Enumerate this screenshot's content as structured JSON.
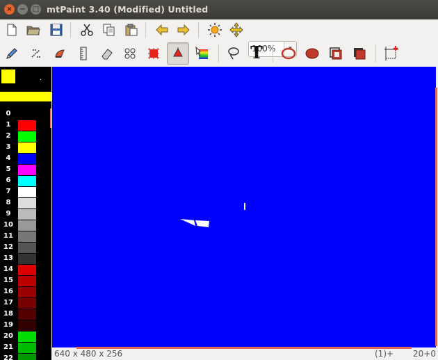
{
  "window": {
    "title": "mtPaint 3.40 (Modified) Untitled",
    "close_glyph": "×",
    "minimize_glyph": "−",
    "maximize_glyph": "□"
  },
  "toolbar_main": {
    "zoom_value": "100%",
    "zoom_arrow": "▾",
    "icons": [
      "new-file-icon",
      "open-folder-icon",
      "save-icon",
      "cut-icon",
      "copy-icon",
      "paste-icon",
      "undo-arrow-icon",
      "redo-arrow-icon",
      "brightness-sun-icon",
      "pan-move-icon"
    ]
  },
  "toolbar_tools": {
    "text_tool_label": "T",
    "overflow_arrow": "▾",
    "active_tool": "fill-tool-icon"
  },
  "palette": {
    "foreground_color": "#ffff00",
    "background_color": "#000000",
    "pattern_color": "#ffff00",
    "entries": [
      {
        "index": "0",
        "color": "#000000"
      },
      {
        "index": "1",
        "color": "#ff0000"
      },
      {
        "index": "2",
        "color": "#00ff00"
      },
      {
        "index": "3",
        "color": "#ffff00"
      },
      {
        "index": "4",
        "color": "#0000ff"
      },
      {
        "index": "5",
        "color": "#ff00ff"
      },
      {
        "index": "6",
        "color": "#00ffff"
      },
      {
        "index": "7",
        "color": "#ffffff"
      },
      {
        "index": "8",
        "color": "#dddddd"
      },
      {
        "index": "9",
        "color": "#bbbbbb"
      },
      {
        "index": "10",
        "color": "#999999"
      },
      {
        "index": "11",
        "color": "#777777"
      },
      {
        "index": "12",
        "color": "#555555"
      },
      {
        "index": "13",
        "color": "#333333"
      },
      {
        "index": "14",
        "color": "#dd0000"
      },
      {
        "index": "15",
        "color": "#bb0000"
      },
      {
        "index": "16",
        "color": "#990000"
      },
      {
        "index": "17",
        "color": "#770000"
      },
      {
        "index": "18",
        "color": "#550000"
      },
      {
        "index": "19",
        "color": "#330000"
      },
      {
        "index": "20",
        "color": "#00dd00"
      },
      {
        "index": "21",
        "color": "#00bb00"
      },
      {
        "index": "22",
        "color": "#009900"
      }
    ]
  },
  "canvas": {
    "background": "#0000ff",
    "stroke_color": "#ffffff"
  },
  "statusbar": {
    "geometry": "640 x 480 x 256",
    "selection": "(1)+",
    "cursor_pos": "20+0"
  }
}
